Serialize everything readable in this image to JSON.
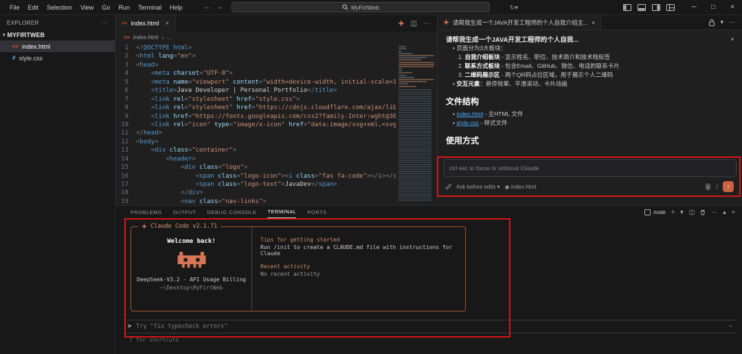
{
  "titlebar": {
    "menus": [
      "File",
      "Edit",
      "Selection",
      "View",
      "Go",
      "Run",
      "Terminal",
      "Help"
    ],
    "search": "MyFirtWeb"
  },
  "icons": {
    "back": "←",
    "forward": "→",
    "dropdown": "▾",
    "more": "⋯",
    "close": "×",
    "minimize": "─",
    "maximize": "□",
    "split": "◫",
    "history": "↻",
    "plus": "+",
    "chevron_up": "▴",
    "context": "◉",
    "slash": "/",
    "send": "↑",
    "collapse": "▾",
    "bullet": "•"
  },
  "explorer": {
    "title": "EXPLORER",
    "folder": "MYFIRTWEB",
    "files": [
      {
        "name": "index.html",
        "icon": "html",
        "glyph": "<>",
        "selected": true
      },
      {
        "name": "style.css",
        "icon": "css",
        "glyph": "#",
        "selected": false
      }
    ]
  },
  "editor": {
    "tab": "index.html",
    "tab_icon_glyph": "<>",
    "breadcrumb_file": "index.html",
    "breadcrumb_sep": "›",
    "breadcrumb_more": "…",
    "lines": [
      [
        [
          "p",
          "<!"
        ],
        [
          "tag",
          "DOCTYPE html"
        ],
        [
          "p",
          ">"
        ]
      ],
      [
        [
          "p",
          "<"
        ],
        [
          "tag",
          "html"
        ],
        [
          "attr",
          " lang"
        ],
        [
          "p",
          "="
        ],
        [
          "str",
          "\"en\""
        ],
        [
          "p",
          ">"
        ]
      ],
      [
        [
          "p",
          "<"
        ],
        [
          "tag",
          "head"
        ],
        [
          "p",
          ">"
        ]
      ],
      [
        [
          "w",
          "    "
        ],
        [
          "p",
          "<"
        ],
        [
          "tag",
          "meta"
        ],
        [
          "attr",
          " charset"
        ],
        [
          "p",
          "="
        ],
        [
          "str",
          "\"UTF-8\""
        ],
        [
          "p",
          ">"
        ]
      ],
      [
        [
          "w",
          "    "
        ],
        [
          "p",
          "<"
        ],
        [
          "tag",
          "meta"
        ],
        [
          "attr",
          " name"
        ],
        [
          "p",
          "="
        ],
        [
          "str",
          "\"viewport\""
        ],
        [
          "attr",
          " content"
        ],
        [
          "p",
          "="
        ],
        [
          "str",
          "\"width=device-width, initial-scale=1"
        ]
      ],
      [
        [
          "w",
          "    "
        ],
        [
          "p",
          "<"
        ],
        [
          "tag",
          "title"
        ],
        [
          "p",
          ">"
        ],
        [
          "t",
          "Java Developer | Personal Portfolio"
        ],
        [
          "p",
          "</"
        ],
        [
          "tag",
          "title"
        ],
        [
          "p",
          ">"
        ]
      ],
      [
        [
          "w",
          "    "
        ],
        [
          "p",
          "<"
        ],
        [
          "tag",
          "link"
        ],
        [
          "attr",
          " rel"
        ],
        [
          "p",
          "="
        ],
        [
          "str",
          "\"stylesheet\""
        ],
        [
          "attr",
          " href"
        ],
        [
          "p",
          "="
        ],
        [
          "str",
          "\"style.css\""
        ],
        [
          "p",
          ">"
        ]
      ],
      [
        [
          "w",
          "    "
        ],
        [
          "p",
          "<"
        ],
        [
          "tag",
          "link"
        ],
        [
          "attr",
          " rel"
        ],
        [
          "p",
          "="
        ],
        [
          "str",
          "\"stylesheet\""
        ],
        [
          "attr",
          " href"
        ],
        [
          "p",
          "="
        ],
        [
          "str",
          "\"https://cdnjs.cloudflare.com/ajax/lib"
        ]
      ],
      [
        [
          "w",
          "    "
        ],
        [
          "p",
          "<"
        ],
        [
          "tag",
          "link"
        ],
        [
          "attr",
          " href"
        ],
        [
          "p",
          "="
        ],
        [
          "str",
          "\"https://fonts.googleapis.com/css2?family-Inter:wght@30"
        ]
      ],
      [
        [
          "w",
          "    "
        ],
        [
          "p",
          "<"
        ],
        [
          "tag",
          "link"
        ],
        [
          "attr",
          " rel"
        ],
        [
          "p",
          "="
        ],
        [
          "str",
          "\"icon\""
        ],
        [
          "attr",
          " type"
        ],
        [
          "p",
          "="
        ],
        [
          "str",
          "\"image/x-icon\""
        ],
        [
          "attr",
          " href"
        ],
        [
          "p",
          "="
        ],
        [
          "str",
          "\"data:image/svg+xml,<svg"
        ]
      ],
      [
        [
          "p",
          "</"
        ],
        [
          "tag",
          "head"
        ],
        [
          "p",
          ">"
        ]
      ],
      [
        [
          "p",
          "<"
        ],
        [
          "tag",
          "body"
        ],
        [
          "p",
          ">"
        ]
      ],
      [
        [
          "w",
          "    "
        ],
        [
          "p",
          "<"
        ],
        [
          "tag",
          "div"
        ],
        [
          "attr",
          " class"
        ],
        [
          "p",
          "="
        ],
        [
          "str",
          "\"container\""
        ],
        [
          "p",
          ">"
        ]
      ],
      [
        [
          "w",
          "        "
        ],
        [
          "p",
          "<"
        ],
        [
          "tag",
          "header"
        ],
        [
          "p",
          ">"
        ]
      ],
      [
        [
          "w",
          "            "
        ],
        [
          "p",
          "<"
        ],
        [
          "tag",
          "div"
        ],
        [
          "attr",
          " class"
        ],
        [
          "p",
          "="
        ],
        [
          "str",
          "\"logo\""
        ],
        [
          "p",
          ">"
        ]
      ],
      [
        [
          "w",
          "                "
        ],
        [
          "p",
          "<"
        ],
        [
          "tag",
          "span"
        ],
        [
          "attr",
          " class"
        ],
        [
          "p",
          "="
        ],
        [
          "str",
          "\"logo-icon\""
        ],
        [
          "p",
          "><"
        ],
        [
          "tag",
          "i"
        ],
        [
          "attr",
          " class"
        ],
        [
          "p",
          "="
        ],
        [
          "str",
          "\"fas fa-code\""
        ],
        [
          "p",
          "></"
        ],
        [
          "tag",
          "i"
        ],
        [
          "p",
          "></"
        ],
        [
          "tag",
          "sp"
        ]
      ],
      [
        [
          "w",
          "                "
        ],
        [
          "p",
          "<"
        ],
        [
          "tag",
          "span"
        ],
        [
          "attr",
          " class"
        ],
        [
          "p",
          "="
        ],
        [
          "str",
          "\"logo-text\""
        ],
        [
          "p",
          ">"
        ],
        [
          "t",
          "JavaDev"
        ],
        [
          "p",
          "</"
        ],
        [
          "tag",
          "span"
        ],
        [
          "p",
          ">"
        ]
      ],
      [
        [
          "w",
          "            "
        ],
        [
          "p",
          "</"
        ],
        [
          "tag",
          "div"
        ],
        [
          "p",
          ">"
        ]
      ],
      [
        [
          "w",
          "            "
        ],
        [
          "p",
          "<"
        ],
        [
          "tag",
          "nav"
        ],
        [
          "attr",
          " class"
        ],
        [
          "p",
          "="
        ],
        [
          "str",
          "\"nav-links\""
        ],
        [
          "p",
          ">"
        ]
      ]
    ]
  },
  "claude": {
    "tab_title": "请帮我生成一个JAVA开发工程师的个人自我介绍主...",
    "summary_line": "请帮我生成一个JAVA开发工程师的个人自我...",
    "intro_line": "页面分为3大板块：",
    "numbered": [
      {
        "bold": "自我介绍板块",
        "rest": " - 显示姓名、职位、技术简介和技术栈标签"
      },
      {
        "bold": "联系方式板块",
        "rest": " - 包含Email、GitHub、微信、电话的联系卡片"
      },
      {
        "bold": "二维码展示区",
        "rest": " - 两个QR码占位区域，用于展示个人二维码"
      }
    ],
    "interaction": {
      "bold": "交互元素",
      "rest": "：悬停效果、平滑滚动、卡片动画"
    },
    "file_structure_heading": "文件结构",
    "file_items": [
      {
        "link": "index.html",
        "rest": " - 主HTML 文件"
      },
      {
        "link": "style.css",
        "rest": " - 样式文件"
      }
    ],
    "usage_heading": "使用方式",
    "input_placeholder": "ctrl esc to focus or unfocus Claude",
    "ask_before": "Ask before edits",
    "context_file": "index.html"
  },
  "panel": {
    "tabs": [
      "PROBLEMS",
      "OUTPUT",
      "DEBUG CONSOLE",
      "TERMINAL",
      "PORTS"
    ],
    "active_tab": "TERMINAL",
    "shell": "node",
    "terminal": {
      "box_title": "Claude Code v2.1.71",
      "welcome": "Welcome back!",
      "model_line": "DeepSeek-V3.2 - API Usage Billing",
      "cwd": "~\\Desktop\\MyFirtWeb",
      "tips_heading": "Tips for getting started",
      "tips_line": "Run /init to create a CLAUDE.md file with instructions for Claude",
      "recent_heading": "Recent activity",
      "recent_line": "No recent activity",
      "prompt_symbol": ">",
      "prompt_hint": "Try \"fix typecheck errors\"",
      "shortcuts": "? for shortcuts"
    }
  }
}
